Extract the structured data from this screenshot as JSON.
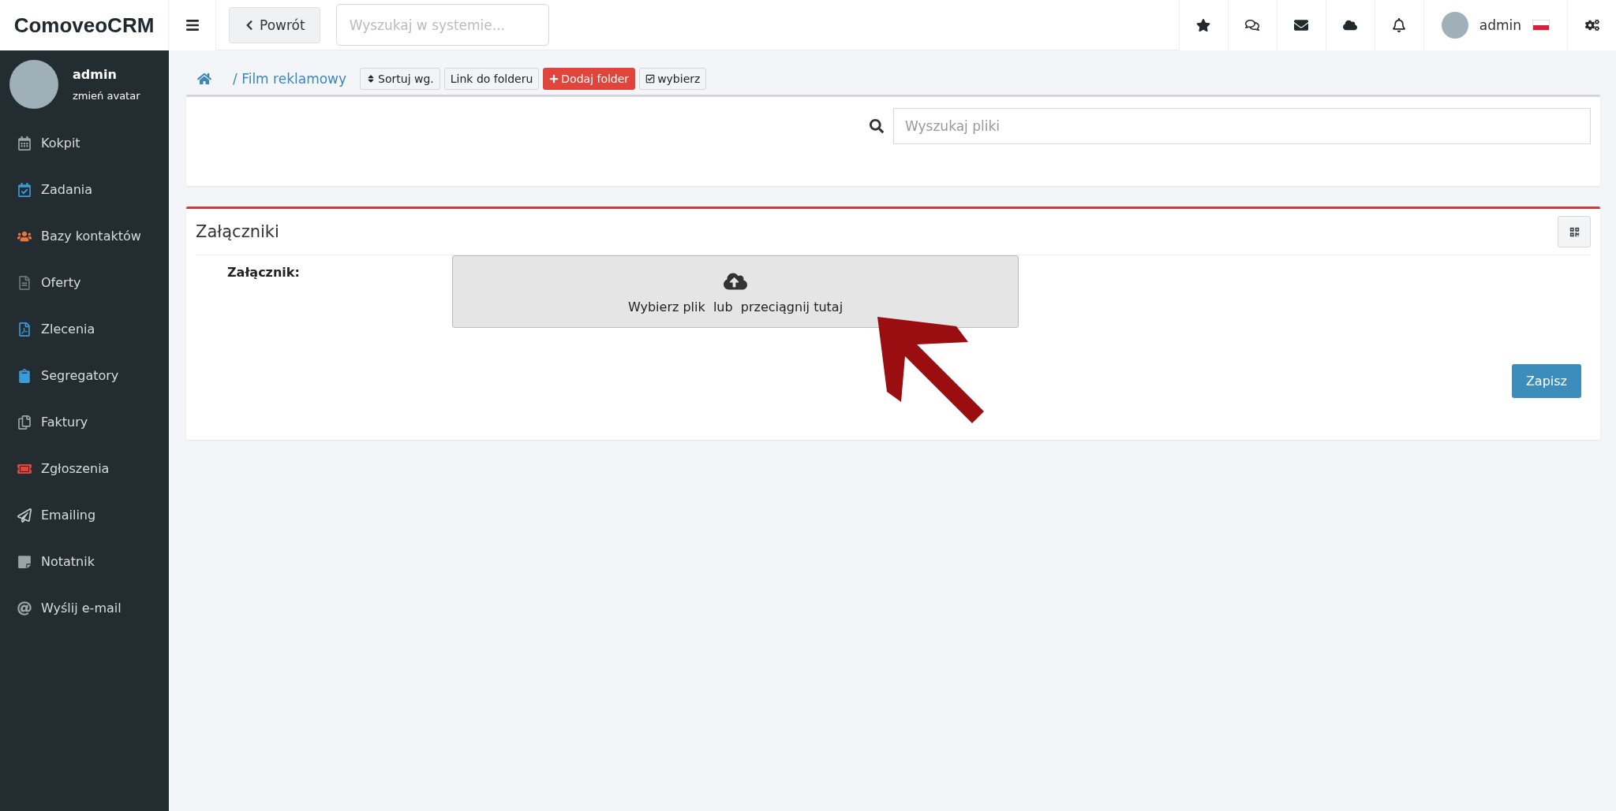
{
  "brand": "ComoveoCRM",
  "topbar": {
    "back_label": "Powrót",
    "search": {
      "placeholder": "Wyszukaj w systemie..."
    },
    "user": "admin"
  },
  "sidebar": {
    "user": {
      "name": "admin",
      "action": "zmień avatar"
    },
    "items": [
      {
        "label": "Kokpit",
        "color": "#9aa3a8"
      },
      {
        "label": "Zadania",
        "color": "#3c9bd6"
      },
      {
        "label": "Bazy kontaktów",
        "color": "#e8783a"
      },
      {
        "label": "Oferty",
        "color": "#6b757a"
      },
      {
        "label": "Zlecenia",
        "color": "#3c9bd6"
      },
      {
        "label": "Segregatory",
        "color": "#3c9bd6"
      },
      {
        "label": "Faktury",
        "color": "#9aa3a8"
      },
      {
        "label": "Zgłoszenia",
        "color": "#e0443a"
      },
      {
        "label": "Emailing",
        "color": "#c8cdd0"
      },
      {
        "label": "Notatnik",
        "color": "#9aa3a8"
      },
      {
        "label": "Wyślij e-mail",
        "color": "#9aa3a8"
      }
    ]
  },
  "breadcrumb": {
    "current": "/ Film reklamowy",
    "buttons": [
      {
        "label": "Sortuj wg.",
        "kind": "sort"
      },
      {
        "label": "Link do folderu",
        "kind": "plain"
      },
      {
        "label": "Dodaj folder",
        "kind": "add"
      },
      {
        "label": "wybierz",
        "kind": "check"
      }
    ]
  },
  "file_search": {
    "placeholder": "Wyszukaj pliki"
  },
  "attachments": {
    "title": "Załączniki",
    "field_label": "Załącznik:",
    "upload_text": "Wybierz plik  lub  przeciągnij tutaj",
    "save": "Zapisz"
  }
}
